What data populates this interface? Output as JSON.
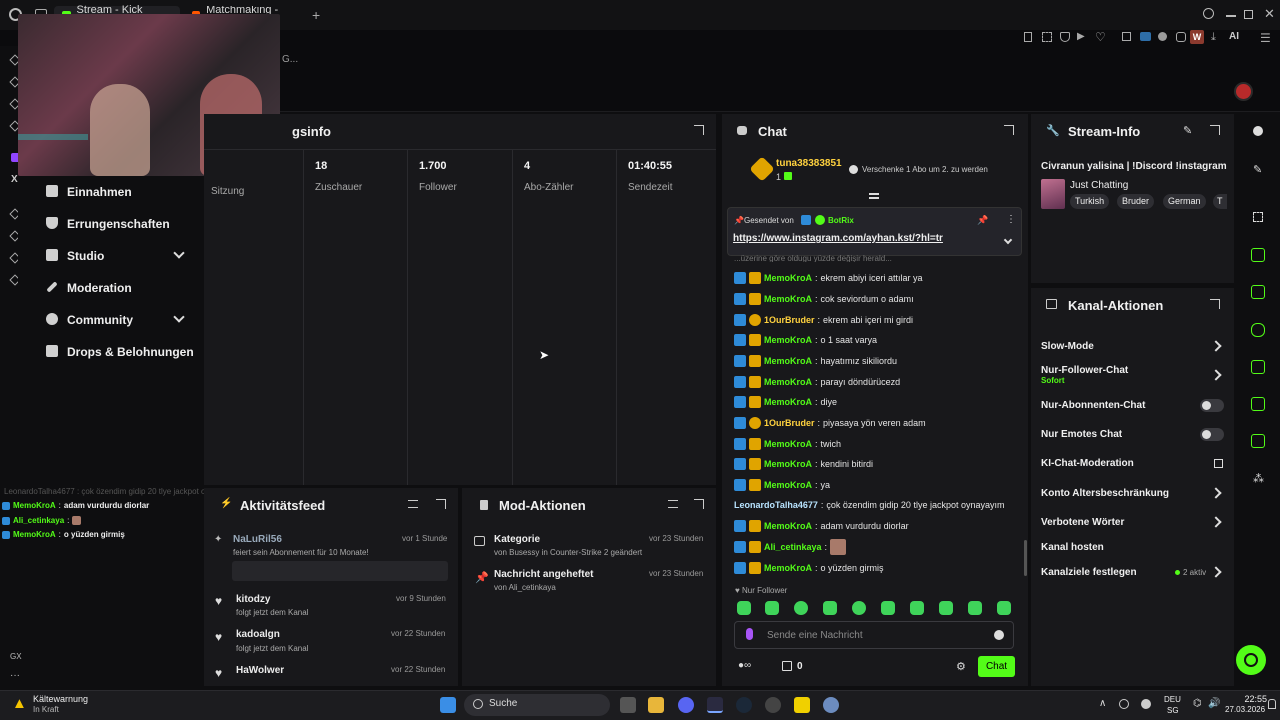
{
  "browser": {
    "tabs": [
      {
        "label": "Stream - Kick Dashboard",
        "active": true
      },
      {
        "label": "Matchmaking - Europe 5v",
        "active": false
      }
    ],
    "address_fragment": "G...",
    "right_label": "AI"
  },
  "sidebar": {
    "items": [
      {
        "label": "Einnahmen",
        "icon": "wallet-icon"
      },
      {
        "label": "Errungenschaften",
        "icon": "trophy-icon"
      },
      {
        "label": "Studio",
        "icon": "studio-icon",
        "expandable": true
      },
      {
        "label": "Moderation",
        "icon": "wrench-icon"
      },
      {
        "label": "Community",
        "icon": "community-icon",
        "expandable": true
      },
      {
        "label": "Drops & Belohnungen",
        "icon": "gift-icon"
      }
    ],
    "overlay_chat": [
      {
        "user": "MemoKroA",
        "text": "adam vurdurdu diorlar"
      },
      {
        "user": "Ali_cetinkaya",
        "text": ""
      },
      {
        "user": "MemoKroA",
        "text": "o yüzden girmiş"
      }
    ],
    "overlay_faded": "LeonardoTalha4677 : çok özendim gidip 20 tlye jackpot oynayayım",
    "bottom_label": "GX"
  },
  "session": {
    "title_partial": "gsinfo",
    "stats": [
      {
        "value": "",
        "label": "Sitzung"
      },
      {
        "value": "18",
        "label": "Zuschauer"
      },
      {
        "value": "1.700",
        "label": "Follower"
      },
      {
        "value": "4",
        "label": "Abo-Zähler"
      },
      {
        "value": "01:40:55",
        "label": "Sendezeit"
      }
    ]
  },
  "activity": {
    "title": "Aktivitätsfeed",
    "items": [
      {
        "user": "NaLuRil56",
        "text": "feiert sein Abonnement für 10 Monate!",
        "time": "vor 1 Stunde"
      },
      {
        "user": "kitodzy",
        "text": "folgt jetzt dem Kanal",
        "time": "vor 9 Stunden"
      },
      {
        "user": "kadoalgn",
        "text": "folgt jetzt dem Kanal",
        "time": "vor 22 Stunden"
      },
      {
        "user": "HaWolwer",
        "text": "",
        "time": "vor 22 Stunden"
      }
    ]
  },
  "modactions": {
    "title": "Mod-Aktionen",
    "items": [
      {
        "title": "Kategorie",
        "detail": "von Busessy in Counter-Strike 2 geändert",
        "time": "vor 23 Stunden"
      },
      {
        "title": "Nachricht angeheftet",
        "detail": "von Ali_cetinkaya",
        "time": "vor 23 Stunden"
      }
    ]
  },
  "chat": {
    "title": "Chat",
    "gift_user": "tuna38383851",
    "gift_count": "1",
    "gift_text": "Verschenke 1 Abo um 2. zu werden",
    "pinned_by_label": "Gesendet von",
    "pinned_by": "BotRix",
    "pinned_link": "https://www.instagram.com/ayhan.kst/?hl=tr",
    "cut_line": "...üzerine göre oldugu yüzde değişir herald...",
    "messages": [
      {
        "user": "MemoKroA",
        "text": "ekrem abiyi iceri attılar ya",
        "badge": "mod"
      },
      {
        "user": "MemoKroA",
        "text": "cok seviordum o adamı",
        "badge": "mod"
      },
      {
        "user": "1OurBruder",
        "text": "ekrem abi içeri mi girdi",
        "badge": "sub"
      },
      {
        "user": "MemoKroA",
        "text": "o 1 saat varya",
        "badge": "mod"
      },
      {
        "user": "MemoKroA",
        "text": "hayatımız sikiliordu",
        "badge": "mod"
      },
      {
        "user": "MemoKroA",
        "text": "parayı döndürücezd",
        "badge": "mod"
      },
      {
        "user": "MemoKroA",
        "text": "diye",
        "badge": "mod"
      },
      {
        "user": "1OurBruder",
        "text": "piyasaya yön veren adam",
        "badge": "sub"
      },
      {
        "user": "MemoKroA",
        "text": "twich",
        "badge": "mod"
      },
      {
        "user": "MemoKroA",
        "text": "kendini bitirdi",
        "badge": "mod"
      },
      {
        "user": "MemoKroA",
        "text": "ya",
        "badge": "mod"
      },
      {
        "user": "LeonardoTalha4677",
        "text": "çok özendim gidip 20 tlye jackpot oynayayım",
        "badge": "none"
      },
      {
        "user": "MemoKroA",
        "text": "adam vurdurdu diorlar",
        "badge": "mod"
      },
      {
        "user": "Ali_cetinkaya",
        "text": "",
        "badge": "mod"
      },
      {
        "user": "MemoKroA",
        "text": "o yüzden girmiş",
        "badge": "mod"
      }
    ],
    "follower_only": "Nur Follower",
    "input_placeholder": "Sende eine Nachricht",
    "viewer_count": "0",
    "send_label": "Chat"
  },
  "streaminfo": {
    "title": "Stream-Info",
    "stream_title": "Civranun yalisina | !Discord !instagram",
    "category": "Just Chatting",
    "tags": [
      "Turkish",
      "Bruder",
      "German",
      "T"
    ]
  },
  "kanal": {
    "title": "Kanal-Aktionen",
    "items": [
      {
        "label": "Slow-Mode",
        "type": "chevron"
      },
      {
        "label": "Nur-Follower-Chat",
        "sub": "Sofort",
        "type": "chevron"
      },
      {
        "label": "Nur-Abonnenten-Chat",
        "type": "toggle"
      },
      {
        "label": "Nur Emotes Chat",
        "type": "toggle"
      },
      {
        "label": "KI-Chat-Moderation",
        "type": "external"
      },
      {
        "label": "Konto Altersbeschränkung",
        "type": "chevron"
      },
      {
        "label": "Verbotene Wörter",
        "type": "chevron"
      },
      {
        "label": "Kanal hosten",
        "type": "none"
      },
      {
        "label": "Kanalziele festlegen",
        "badge": "2 aktiv",
        "type": "chevron"
      }
    ]
  },
  "taskbar": {
    "weather_title": "Kältewarnung",
    "weather_sub": "In Kraft",
    "search": "Suche",
    "lang1": "DEU",
    "lang2": "SG",
    "time": "22:55",
    "date": "27.03.2026"
  },
  "colors": {
    "accent": "#53fc18",
    "panel": "#18181b",
    "bg": "#0e0e10"
  }
}
